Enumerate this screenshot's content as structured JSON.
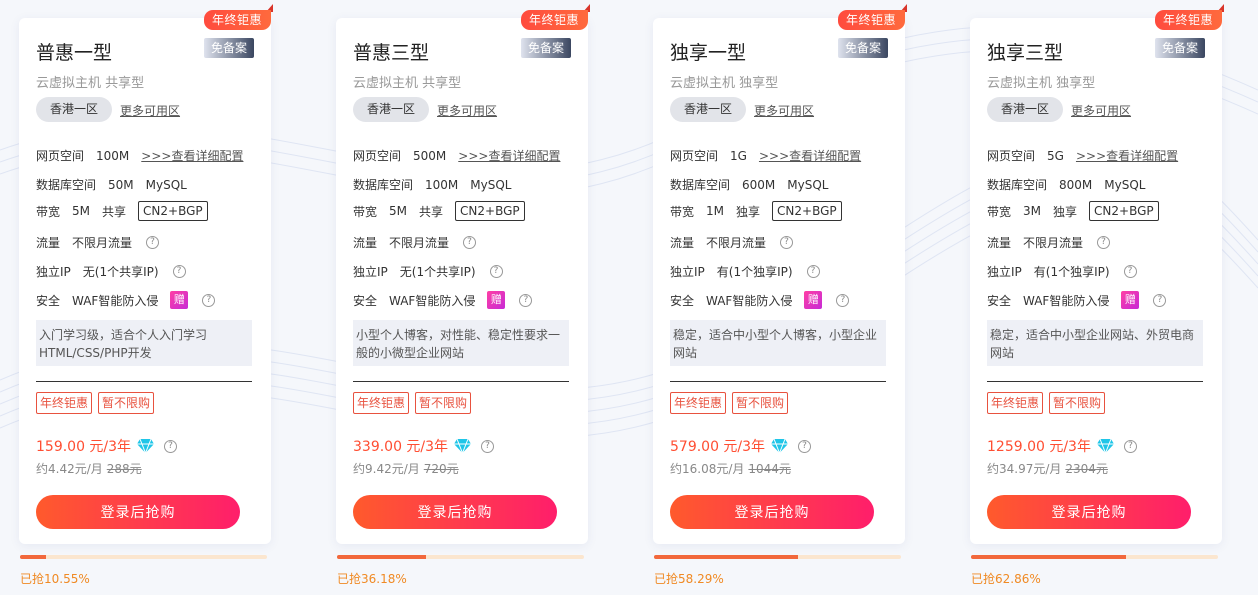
{
  "colors": {
    "accent": "#ff4e32",
    "progress_fill": "#f2683c",
    "progress_track": "#fbe6cf",
    "sold_text": "#f08a24"
  },
  "labels": {
    "web_space": "网页空间",
    "db_space": "数据库空间",
    "bandwidth": "带宽",
    "traffic": "流量",
    "dedicated_ip": "独立IP",
    "security": "安全",
    "detail_link": ">>>查看详细配置",
    "more_regions": "更多可用区",
    "buy_button": "登录后抢购",
    "gift": "赠"
  },
  "products": [
    {
      "ribbon": "年终钜惠",
      "name": "普惠一型",
      "badge": "免备案",
      "subtitle": "云虚拟主机 共享型",
      "region": "香港一区",
      "web_space": "100M",
      "db_space": "50M",
      "db_type": "MySQL",
      "bandwidth": "5M",
      "bandwidth_type": "共享",
      "line": "CN2+BGP",
      "traffic": "不限月流量",
      "ip": "无(1个共享IP)",
      "security": "WAF智能防入侵",
      "desc": "入门学习级，适合个人入门学习HTML/CSS/PHP开发",
      "promo": [
        "年终钜惠",
        "暂不限购"
      ],
      "price": "159.00 元/3年",
      "monthly": "约4.42元/月",
      "original": "288元",
      "sold_label": "已抢10.55%",
      "sold_percent": 10.55
    },
    {
      "ribbon": "年终钜惠",
      "name": "普惠三型",
      "badge": "免备案",
      "subtitle": "云虚拟主机 共享型",
      "region": "香港一区",
      "web_space": "500M",
      "db_space": "100M",
      "db_type": "MySQL",
      "bandwidth": "5M",
      "bandwidth_type": "共享",
      "line": "CN2+BGP",
      "traffic": "不限月流量",
      "ip": "无(1个共享IP)",
      "security": "WAF智能防入侵",
      "desc": "小型个人博客，对性能、稳定性要求一般的小微型企业网站",
      "promo": [
        "年终钜惠",
        "暂不限购"
      ],
      "price": "339.00 元/3年",
      "monthly": "约9.42元/月",
      "original": "720元",
      "sold_label": "已抢36.18%",
      "sold_percent": 36.18
    },
    {
      "ribbon": "年终钜惠",
      "name": "独享一型",
      "badge": "免备案",
      "subtitle": "云虚拟主机 独享型",
      "region": "香港一区",
      "web_space": "1G",
      "db_space": "600M",
      "db_type": "MySQL",
      "bandwidth": "1M",
      "bandwidth_type": "独享",
      "line": "CN2+BGP",
      "traffic": "不限月流量",
      "ip": "有(1个独享IP)",
      "security": "WAF智能防入侵",
      "desc": "稳定，适合中小型个人博客，小型企业网站",
      "promo": [
        "年终钜惠",
        "暂不限购"
      ],
      "price": "579.00 元/3年",
      "monthly": "约16.08元/月",
      "original": "1044元",
      "sold_label": "已抢58.29%",
      "sold_percent": 58.29
    },
    {
      "ribbon": "年终钜惠",
      "name": "独享三型",
      "badge": "免备案",
      "subtitle": "云虚拟主机 独享型",
      "region": "香港一区",
      "web_space": "5G",
      "db_space": "800M",
      "db_type": "MySQL",
      "bandwidth": "3M",
      "bandwidth_type": "独享",
      "line": "CN2+BGP",
      "traffic": "不限月流量",
      "ip": "有(1个独享IP)",
      "security": "WAF智能防入侵",
      "desc": "稳定，适合中小型企业网站、外贸电商网站",
      "promo": [
        "年终钜惠",
        "暂不限购"
      ],
      "price": "1259.00 元/3年",
      "monthly": "约34.97元/月",
      "original": "2304元",
      "sold_label": "已抢62.86%",
      "sold_percent": 62.86
    }
  ]
}
